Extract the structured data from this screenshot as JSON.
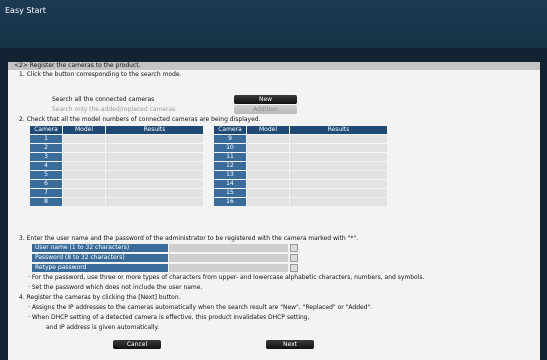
{
  "window": {
    "title": "Easy Start"
  },
  "step": {
    "header": "<2> Register the cameras to the product."
  },
  "search": {
    "instruction": "1. Click the button corresponding to the search mode.",
    "all_label": "Search all the connected cameras",
    "new_button": "New",
    "added_label": "Search only the  added/replaced cameras",
    "addition_button": "Addition"
  },
  "check": {
    "instruction": "2. Check that all the model numbers of connected cameras are being displayed.",
    "columns": [
      "Camera",
      "Model",
      "Results"
    ],
    "left_cameras": [
      "1",
      "2",
      "3",
      "4",
      "5",
      "6",
      "7",
      "8"
    ],
    "right_cameras": [
      "9",
      "10",
      "11",
      "12",
      "13",
      "14",
      "15",
      "16"
    ]
  },
  "credentials": {
    "instruction": "3. Enter the user name and the password of the administrator to be registered with the camera marked with \"*\".",
    "user_label": "User name (1 to 32 characters)",
    "password_label": "Password (8 to 32 characters)",
    "retype_label": "Retype password",
    "note1": "· For the password, use three or more types of characters from upper- and lowercase alphabetic characters, numbers, and symbols.",
    "note2": "· Set the password which does not include the user name."
  },
  "register": {
    "instruction": "4. Register the cameras by clicking the [Next] button.",
    "note1": "· Assigns the IP addresses to the cameras automatically when the search result are \"New\", \"Replaced\" or \"Added\".",
    "note2": "· When DHCP setting of a detected camera is effective, this product invalidates DHCP setting,",
    "note3": "and IP address is given automatically."
  },
  "footer": {
    "cancel_button": "Cancel",
    "next_button": "Next"
  }
}
